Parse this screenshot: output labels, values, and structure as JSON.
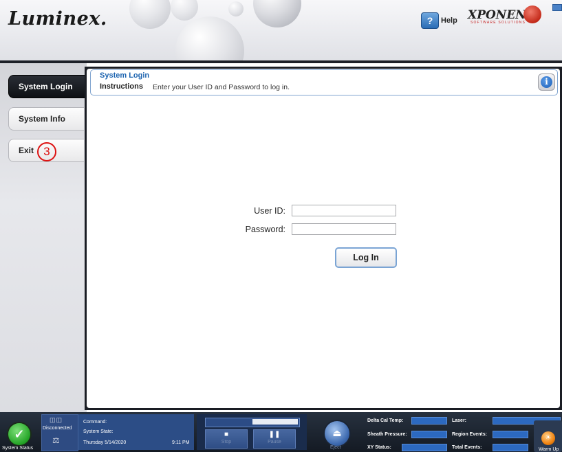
{
  "header": {
    "logo": "Luminex.",
    "help_icon": "?",
    "help_label": "Help",
    "brand": "XPONENT.",
    "brand_sub": "SOFTWARE SOLUTIONS"
  },
  "nav": {
    "items": [
      {
        "label": "System Login",
        "active": true
      },
      {
        "label": "System Info",
        "active": false
      },
      {
        "label": "Exit",
        "active": false
      }
    ],
    "annotation": "3"
  },
  "instructions": {
    "title": "System Login",
    "label": "Instructions",
    "text": "Enter your User ID and Password to log in.",
    "info_icon": "i"
  },
  "login": {
    "user_label": "User ID:",
    "user_value": "",
    "password_label": "Password:",
    "password_value": "",
    "button_label": "Log In"
  },
  "statusbar": {
    "system_status_label": "System Status",
    "connection_label": "Disconnected",
    "command_label": "Command:",
    "state_label": "System State:",
    "date": "Thursday 5/14/2020",
    "time": "9:11 PM",
    "progress": 0.5,
    "stop_label": "Stop",
    "pause_label": "Pause",
    "eject_label": "Eject",
    "metrics": [
      {
        "label": "Delta Cal Temp:",
        "value": ""
      },
      {
        "label": "Sheath Pressure:",
        "value": ""
      },
      {
        "label": "XY Status:",
        "value": ""
      },
      {
        "label": "Laser:",
        "value": ""
      },
      {
        "label": "Region Events:",
        "value": ""
      },
      {
        "label": "Total Events:",
        "value": ""
      }
    ],
    "warmup_label": "Warm Up"
  },
  "colors": {
    "accent": "#1d64b0",
    "status_ok": "#23a325",
    "statusbar_bg": "#141a23",
    "annotation": "#dd1111"
  }
}
